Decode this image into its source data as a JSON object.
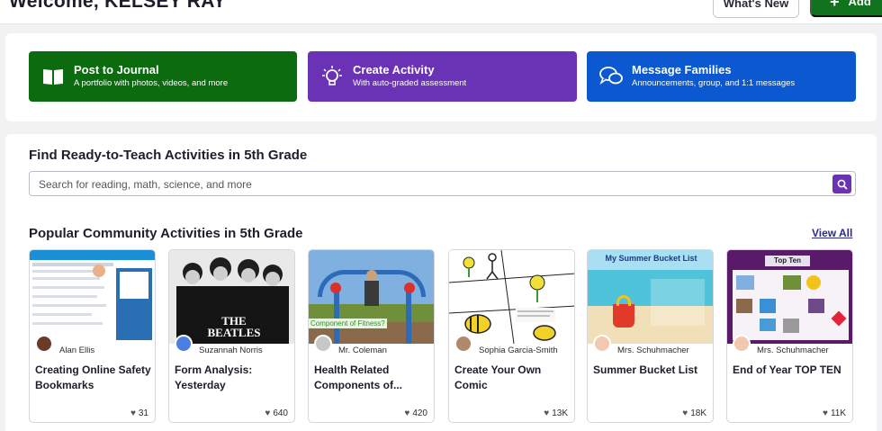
{
  "header": {
    "welcome": "Welcome, KELSEY RAY",
    "whats_new": "What's New",
    "add_label": "Add"
  },
  "actions": [
    {
      "title": "Post to Journal",
      "subtitle": "A portfolio with photos, videos, and more",
      "icon": "book-open-icon",
      "color": "#0b6b0e"
    },
    {
      "title": "Create Activity",
      "subtitle": "With auto-graded assessment",
      "icon": "lightbulb-icon",
      "color": "#6a32b5"
    },
    {
      "title": "Message Families",
      "subtitle": "Announcements, group, and 1:1 messages",
      "icon": "chat-bubbles-icon",
      "color": "#0b58d1"
    }
  ],
  "find": {
    "title": "Find Ready-to-Teach Activities in 5th Grade",
    "placeholder": "Search for reading, math, science, and more"
  },
  "popular": {
    "title": "Popular Community Activities in 5th Grade",
    "view_all": "View All"
  },
  "cards": [
    {
      "author": "Alan Ellis",
      "title": "Creating Online Safety Bookmarks",
      "likes": "31"
    },
    {
      "author": "Suzannah Norris",
      "title": "Form Analysis: Yesterday",
      "likes": "640",
      "thumb_text": "THE BEATLES"
    },
    {
      "author": "Mr. Coleman",
      "title": "Health Related Components of...",
      "likes": "420",
      "thumb_text": "Component of Fitness?"
    },
    {
      "author": "Sophia Garcia-Smith",
      "title": "Create Your Own Comic",
      "likes": "13K"
    },
    {
      "author": "Mrs. Schuhmacher",
      "title": "Summer Bucket List",
      "likes": "18K",
      "thumb_text": "My Summer Bucket List"
    },
    {
      "author": "Mrs. Schuhmacher",
      "title": "End of Year TOP TEN",
      "likes": "11K",
      "thumb_text": "Top Ten"
    }
  ],
  "colors": {
    "accent_green": "#12731f",
    "accent_purple": "#6a32b5",
    "accent_blue": "#0b58d1",
    "link": "#2b2a8f"
  }
}
